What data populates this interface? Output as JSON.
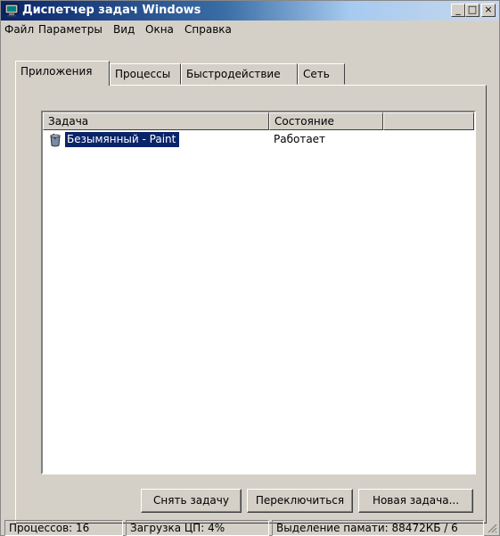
{
  "window": {
    "title": "Диспетчер задач Windows",
    "minimize": "_",
    "maximize": "□",
    "close": "×"
  },
  "menu": [
    "Файл",
    "Параметры",
    "Вид",
    "Окна",
    "Справка"
  ],
  "tabs": [
    "Приложения",
    "Процессы",
    "Быстродействие",
    "Сеть"
  ],
  "active_tab": "Приложения",
  "list": {
    "columns": [
      "Задача",
      "Состояние"
    ],
    "rows": [
      {
        "name": "Безымянный - Paint",
        "status": "Работает",
        "icon": "paint-bucket-icon"
      }
    ]
  },
  "buttons": {
    "end_task": "Снять задачу",
    "switch_to": "Переключиться",
    "new_task": "Новая задача..."
  },
  "status": {
    "processes": "Процессов: 16",
    "cpu": "Загрузка ЦП: 4%",
    "memory": "Выделение памати: 88472КБ / 6"
  },
  "colors": {
    "title_start": "#0a246a",
    "title_end": "#a6caf0",
    "selection": "#0a246a",
    "face": "#d4d0c8"
  }
}
